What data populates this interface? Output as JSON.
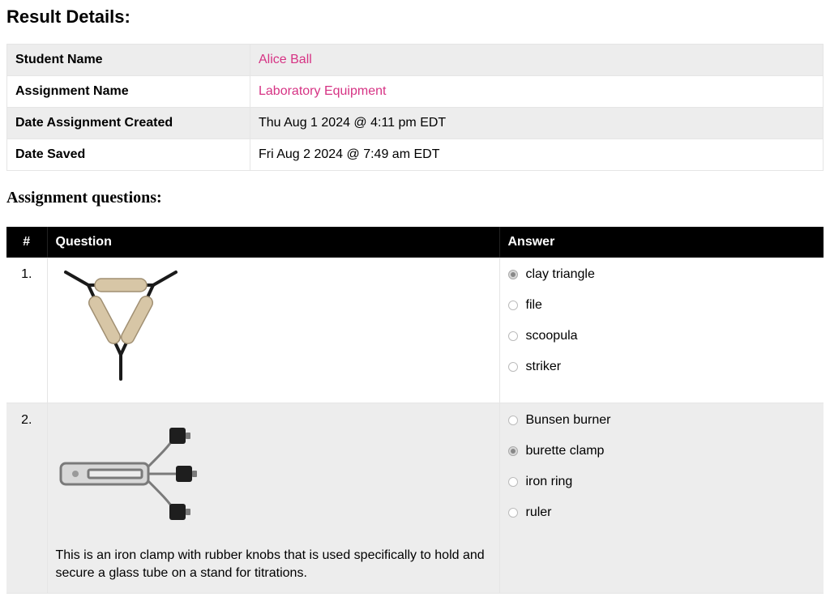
{
  "header": {
    "title": "Result Details:"
  },
  "details": {
    "rows": [
      {
        "key": "Student Name",
        "value": "Alice Ball",
        "link": true
      },
      {
        "key": "Assignment Name",
        "value": "Laboratory Equipment",
        "link": true
      },
      {
        "key": "Date Assignment Created",
        "value": "Thu Aug 1 2024 @ 4:11 pm EDT",
        "link": false
      },
      {
        "key": "Date Saved",
        "value": "Fri Aug 2 2024 @ 7:49 am EDT",
        "link": false
      }
    ]
  },
  "subheading": "Assignment questions:",
  "qtable": {
    "headers": {
      "num": "#",
      "question": "Question",
      "answer": "Answer"
    }
  },
  "questions": [
    {
      "num": "1.",
      "image": "clay-triangle",
      "description": "",
      "options": [
        {
          "label": "clay triangle",
          "selected": true
        },
        {
          "label": "file",
          "selected": false
        },
        {
          "label": "scoopula",
          "selected": false
        },
        {
          "label": "striker",
          "selected": false
        }
      ]
    },
    {
      "num": "2.",
      "image": "burette-clamp",
      "description": "This is an iron clamp with rubber knobs that is used specifically to hold and secure a glass tube on a stand for titrations.",
      "options": [
        {
          "label": "Bunsen burner",
          "selected": false
        },
        {
          "label": "burette clamp",
          "selected": true
        },
        {
          "label": "iron ring",
          "selected": false
        },
        {
          "label": "ruler",
          "selected": false
        }
      ]
    }
  ]
}
